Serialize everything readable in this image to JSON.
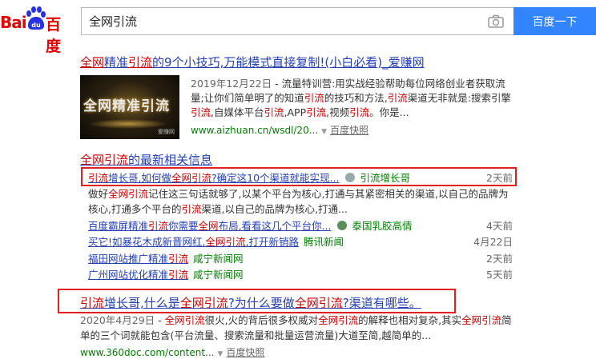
{
  "header": {
    "logo_bai": "Bai",
    "logo_du": "du",
    "logo_cn": "百度",
    "query": "全网引流",
    "search_button": "百度一下",
    "brand_color": "#e10601",
    "button_color": "#3385ff"
  },
  "result1": {
    "title_hl1": "全网",
    "title_p1": "精准",
    "title_hl2": "引流",
    "title_p2": "的9个小技巧,万能模式直接复制!(小白必看)_爱赚网",
    "thumb_text": "全网精准引流",
    "thumb_watermark": "爱赚网",
    "date": "2019年12月22日",
    "desc": "- 流量特训营:用实战经验帮助每位网络创业者获取流量;让你们简单明了的知道引流的技巧和方法,引流渠道无非就是:搜索引擎引流,自媒体平台引流,APP引流,视频引流。你是...",
    "url": "www.aizhuan.cn/wsdl/20...",
    "snapshot": "百度快照"
  },
  "result2": {
    "title_hl": "全网引流",
    "title_rest": "的最新相关信息",
    "items": [
      {
        "link": "引流增长哥,如何做全网引流?确定这10个渠道就能实现...",
        "source": "引流增长哥",
        "time": "2天前"
      },
      {
        "link": "百度霸屏精准引流你需要全网布局,看看这几个平台你...",
        "source": "泰国乳胶高倩",
        "time": "4天前"
      },
      {
        "link": "买它!如暴花木成新晋网红,全网引流,打开新销路",
        "source": "腾讯新闻",
        "time": "4月22日"
      },
      {
        "link": "福田网站推广精准引流",
        "source": "咸宁新闻网",
        "time": "2天前"
      },
      {
        "link": "广州网站优化精准引流",
        "source": "咸宁新闻网",
        "time": "5天前"
      }
    ],
    "item1_desc": "做好全网引流记住这三句话就够了,以某个平台为核心,打通与其紧密相关的渠道,以自己的品牌为核心,打通多个平台的引流渠道,以自己的品牌为核心,打通..."
  },
  "result3": {
    "title": "引流增长哥,什么是全网引流?为什么要做全网引流?渠道有哪些。",
    "date": "2020年4月29日",
    "desc": "- 全网引流很火,火的背后很多权威对全网引流的解释也相对复杂,其实全网引流简单的三个词就能包含(平台流量、搜索流量和批量运营流量)大道至简,越简单的...",
    "url": "www.360doc.com/content...",
    "snapshot": "百度快照"
  }
}
